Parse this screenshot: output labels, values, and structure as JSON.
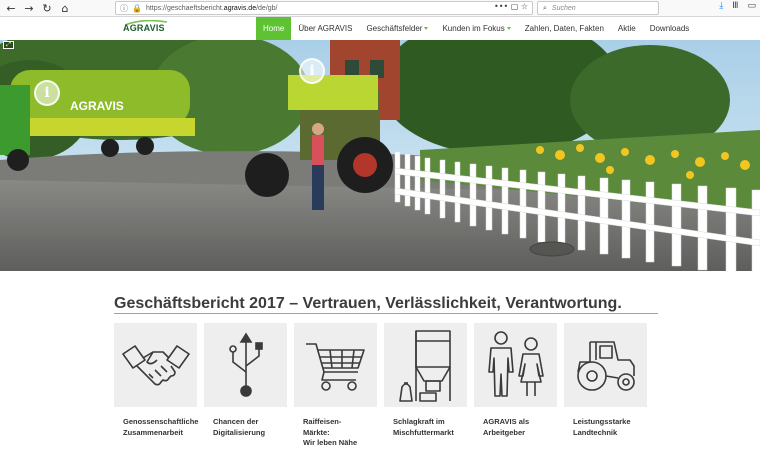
{
  "browser": {
    "url_prefix": "https://geschaeftsbericht.",
    "url_domain": "agravis.de",
    "url_path": "/de/gb/",
    "url_actions": "•••  ▢  ☆",
    "search_placeholder": "Suchen"
  },
  "header": {
    "logo_text": "AGRAVIS",
    "nav": [
      {
        "label": "Home"
      },
      {
        "label": "Über AGRAVIS"
      },
      {
        "label": "Geschäftsfelder"
      },
      {
        "label": "Kunden im Fokus"
      },
      {
        "label": "Zahlen, Daten, Fakten"
      },
      {
        "label": "Aktie"
      },
      {
        "label": "Downloads"
      }
    ]
  },
  "hero": {
    "tanker_text": "AGRAVIS",
    "toggle_symbol": "⤢",
    "hotspot_symbol": "i"
  },
  "main": {
    "headline": "Geschäftsbericht 2017 – Vertrauen, Verlässlichkeit, Verantwortung.",
    "cards": [
      {
        "line1": "Genossenschaftliche",
        "line2": "Zusammenarbeit",
        "icon": "handshake-icon"
      },
      {
        "line1": "Chancen der",
        "line2": "Digitalisierung",
        "icon": "usb-icon"
      },
      {
        "line1": "Raiffeisen-Märkte:",
        "line2": "Wir leben Nähe",
        "icon": "shopping-cart-icon"
      },
      {
        "line1": "Schlagkraft im",
        "line2": "Mischfuttermarkt",
        "icon": "silo-icon"
      },
      {
        "line1": "AGRAVIS als",
        "line2": "Arbeitgeber",
        "icon": "people-icon"
      },
      {
        "line1": "Leistungsstarke",
        "line2": "Landtechnik",
        "icon": "tractor-icon"
      }
    ]
  },
  "colors": {
    "accent_green": "#5ec232",
    "rule_green": "#7cc451",
    "logo_green": "#1e5a2c"
  }
}
